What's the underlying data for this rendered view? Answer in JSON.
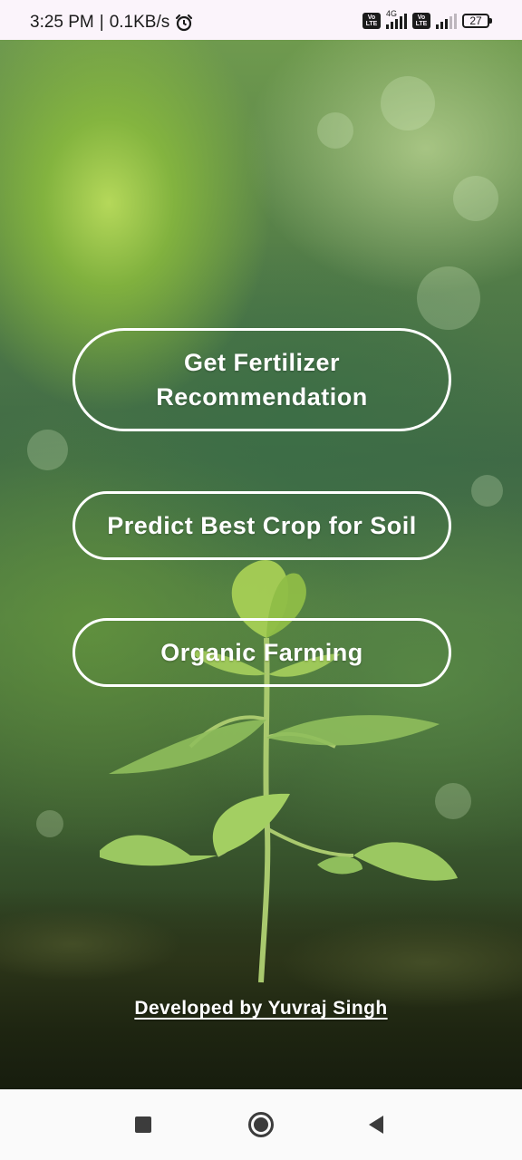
{
  "status_bar": {
    "time": "3:25 PM",
    "separator": "|",
    "speed": "0.1KB/s",
    "network_type": "4G",
    "volte_top": "Vo",
    "volte_bottom": "LTE",
    "battery_level": "27",
    "icons": [
      "alarm-icon",
      "volte-icon",
      "signal-icon",
      "volte-icon",
      "signal-icon",
      "battery-icon"
    ]
  },
  "main": {
    "buttons": [
      {
        "label": "Get Fertilizer Recommendation"
      },
      {
        "label": "Predict Best Crop for Soil"
      },
      {
        "label": "Organic Farming"
      }
    ],
    "credit": "Developed by Yuvraj Singh"
  },
  "nav_bar": {
    "icons": [
      "recents-icon",
      "home-icon",
      "back-icon"
    ]
  },
  "colors": {
    "status_bar_bg": "#fbf4fb",
    "button_border": "#ffffff",
    "button_text": "#ffffff",
    "nav_bar_bg": "#fafafa",
    "nav_icon": "#3c3c3c"
  }
}
